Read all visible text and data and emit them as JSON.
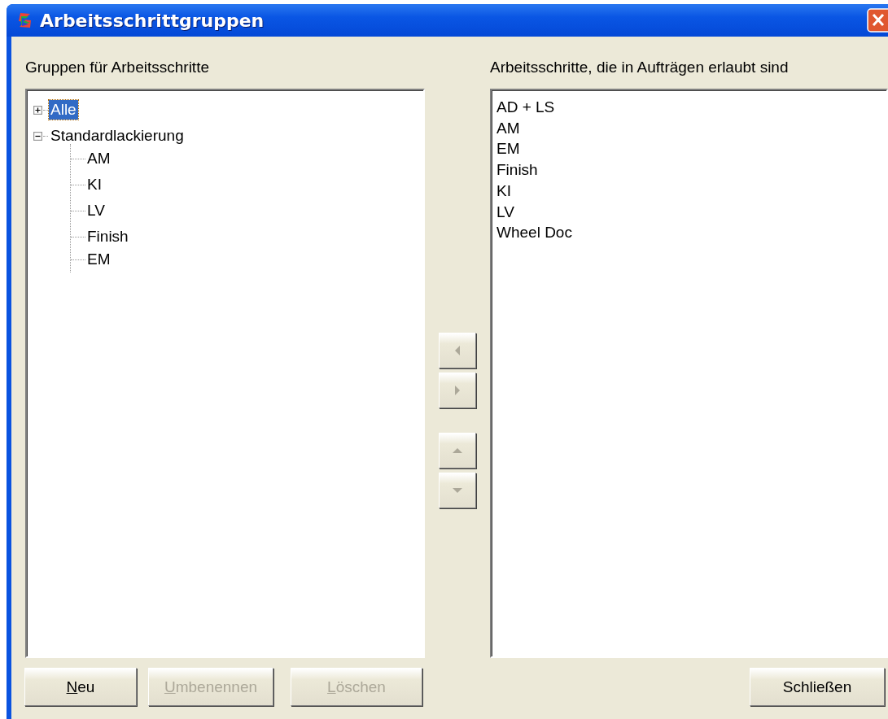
{
  "window": {
    "title": "Arbeitsschrittgruppen"
  },
  "groups_panel": {
    "label": "Gruppen für Arbeitsschritte",
    "tree": [
      {
        "label": "Alle",
        "expanded": false,
        "selected": true
      },
      {
        "label": "Standardlackierung",
        "expanded": true,
        "selected": false,
        "children": [
          {
            "label": "AM",
            "selected": false
          },
          {
            "label": "KI",
            "selected": false
          },
          {
            "label": "LV",
            "selected": false
          },
          {
            "label": "Finish",
            "selected": false
          },
          {
            "label": "EM",
            "selected": false
          }
        ]
      }
    ]
  },
  "arrow_buttons": [
    {
      "kind": "left",
      "disabled": true
    },
    {
      "kind": "right",
      "disabled": true
    },
    {
      "kind": "up",
      "disabled": true
    },
    {
      "kind": "down",
      "disabled": true
    }
  ],
  "steps_panel": {
    "label": "Arbeitsschritte, die in Aufträgen erlaubt sind",
    "items": [
      {
        "label": "AD + LS",
        "selected": false
      },
      {
        "label": "AM",
        "selected": false
      },
      {
        "label": "EM",
        "selected": false
      },
      {
        "label": "Finish",
        "selected": false
      },
      {
        "label": "KI",
        "selected": false
      },
      {
        "label": "LV",
        "selected": false
      },
      {
        "label": "Wheel Doc",
        "selected": false
      }
    ]
  },
  "buttons": [
    {
      "label": "Neu",
      "disabled": false
    },
    {
      "label": "Umbenennen",
      "disabled": true
    },
    {
      "label": "Löschen",
      "disabled": true
    }
  ],
  "close_button": {
    "label": "Schließen",
    "disabled": false
  }
}
